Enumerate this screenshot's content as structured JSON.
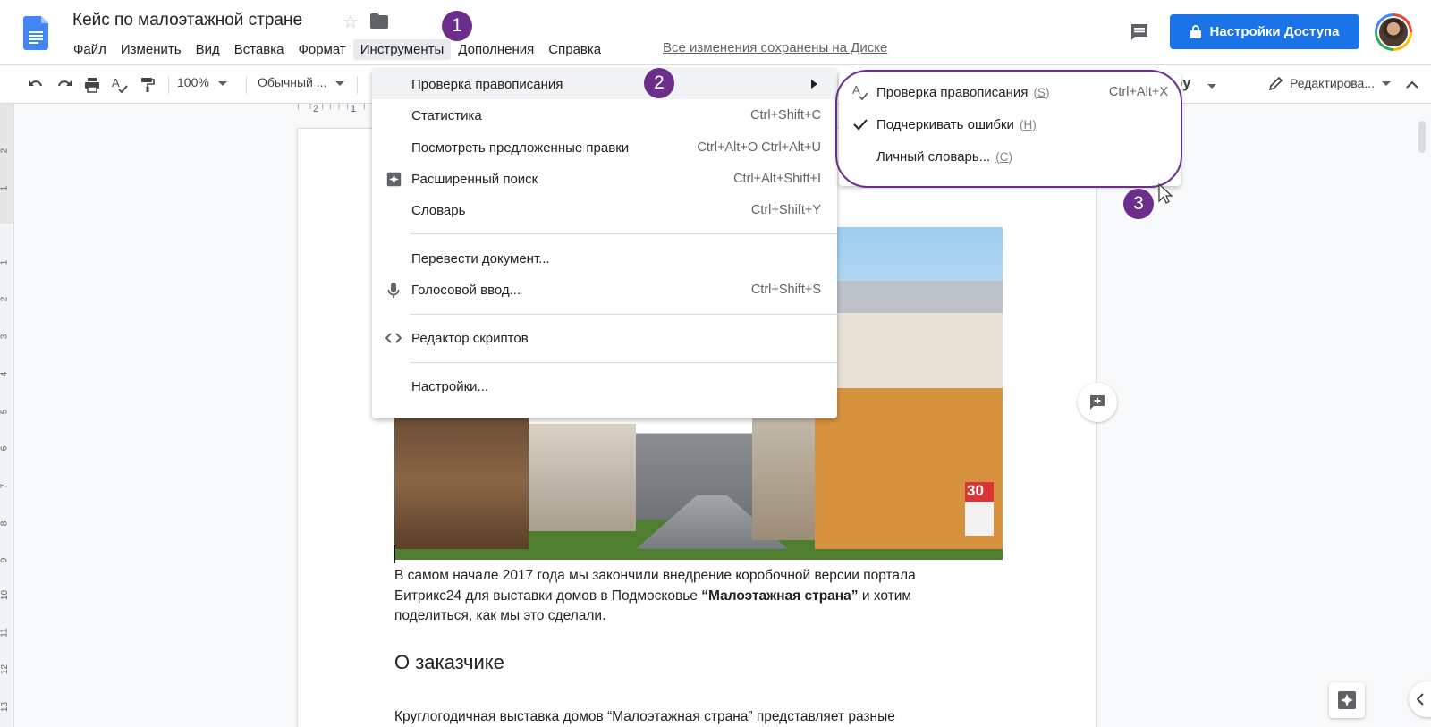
{
  "header": {
    "doc_title": "Кейс по малоэтажной стране",
    "menu": [
      "Файл",
      "Изменить",
      "Вид",
      "Вставка",
      "Формат",
      "Инструменты",
      "Дополнения",
      "Справка"
    ],
    "saved_status": "Все изменения сохранены на Диске",
    "share_label": "Настройки Доступа"
  },
  "toolbar": {
    "zoom": "100%",
    "style": "Обычный ...",
    "font_partial": "ру",
    "editing_mode": "Редактирова..."
  },
  "ruler": {
    "top_ticks": [
      "2",
      "1"
    ],
    "side_ticks": [
      "2",
      "1",
      "1",
      "2",
      "3",
      "4",
      "5",
      "6",
      "7",
      "8",
      "9",
      "10",
      "11",
      "12",
      "13"
    ]
  },
  "tools_menu": {
    "items": [
      {
        "label": "Проверка правописания",
        "shortcut": "",
        "icon": "",
        "submenu": true
      },
      {
        "label": "Статистика",
        "shortcut": "Ctrl+Shift+C",
        "icon": ""
      },
      {
        "label": "Посмотреть предложенные правки",
        "shortcut": "Ctrl+Alt+O Ctrl+Alt+U",
        "icon": ""
      },
      {
        "label": "Расширенный поиск",
        "shortcut": "Ctrl+Alt+Shift+I",
        "icon": "explore-icon"
      },
      {
        "label": "Словарь",
        "shortcut": "Ctrl+Shift+Y",
        "icon": ""
      },
      {
        "label": "Перевести документ...",
        "shortcut": "",
        "icon": ""
      },
      {
        "label": "Голосовой ввод...",
        "shortcut": "Ctrl+Shift+S",
        "icon": "mic-icon"
      },
      {
        "label": "Редактор скриптов",
        "shortcut": "",
        "icon": "code-icon"
      },
      {
        "label": "Настройки...",
        "shortcut": "",
        "icon": ""
      }
    ]
  },
  "spellcheck_submenu": {
    "items": [
      {
        "label": "Проверка правописания",
        "hint": "(S)",
        "shortcut": "Ctrl+Alt+X",
        "icon": "spellcheck-icon"
      },
      {
        "label": "Подчеркивать ошибки",
        "hint": "(Н)",
        "shortcut": "",
        "icon": "check-icon"
      },
      {
        "label": "Личный словарь...",
        "hint": "(С)",
        "shortcut": "",
        "icon": ""
      }
    ]
  },
  "badges": [
    "1",
    "2",
    "3"
  ],
  "document": {
    "para1_a": "В самом начале 2017 года мы закончили внедрение коробочной версии портала Битрикс24 для выставки домов в Подмосковье ",
    "para1_bold": "“Малоэтажная страна”",
    "para1_b": " и хотим поделиться, как мы это сделали.",
    "heading_customer": "О заказчике",
    "para2": "Круглогодичная выставка домов “Малоэтажная страна” представляет разные",
    "photo_sign": "30"
  },
  "colors": {
    "accent": "#1a73e8",
    "annotation": "#6b2e8a",
    "docs_blue": "#4285f4"
  }
}
